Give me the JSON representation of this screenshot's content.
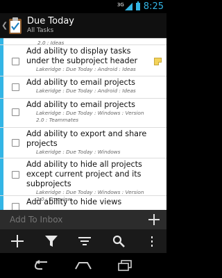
{
  "status_bar": {
    "network": "3G",
    "time": "8:25"
  },
  "action_bar": {
    "title": "Due Today",
    "subtitle": "All Tasks"
  },
  "tasks": [
    {
      "title": "",
      "path": "2.0 : Ideas"
    },
    {
      "title": "Add ability to display tasks under the subproject header",
      "path": "Lakeridge : Due Today : Android : Ideas",
      "has_note": true
    },
    {
      "title": "Add ability to email projects",
      "path": "Lakeridge : Due Today : Android : Ideas"
    },
    {
      "title": "Add ability to email projects",
      "path": "Lakeridge : Due Today : Windows : Version 2.0 : Teammates"
    },
    {
      "title": "Add ability to export and share projects",
      "path": "Lakeridge : Due Today : Windows"
    },
    {
      "title": "Add ability to hide all projects except current project and its subprojects",
      "path": "Lakeridge : Due Today : Windows : Version 2.0 : Treeview"
    },
    {
      "title": "Add ability to hide views",
      "path": ""
    }
  ],
  "quick_add": {
    "placeholder": "Add To Inbox"
  },
  "toolbar": {
    "items": [
      "add-icon",
      "filter-icon",
      "sort-icon",
      "search-icon",
      "overflow-menu-icon"
    ]
  },
  "colors": {
    "accent": "#33b5e5",
    "note": "#f3d35a"
  }
}
